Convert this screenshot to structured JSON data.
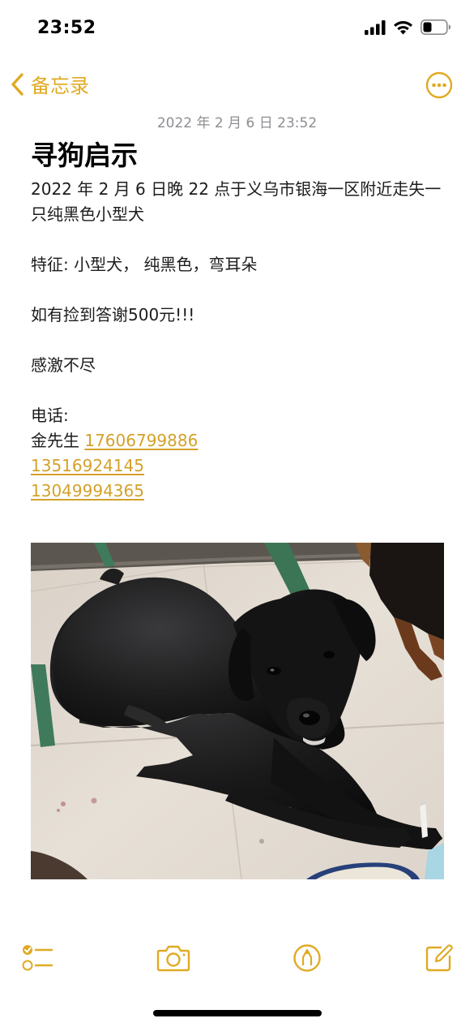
{
  "status_bar": {
    "time": "23:52"
  },
  "nav": {
    "back_label": "备忘录",
    "back_icon": "chevron-left-icon",
    "more_icon": "ellipsis-circle-icon"
  },
  "note": {
    "date": "2022 年 2 月 6 日 23:52",
    "title": "寻狗启示",
    "line1": "2022 年 2 月 6 日晚 22 点于义乌市银海一区附近走失一只纯黑色小型犬",
    "features": "特征: 小型犬， 纯黑色，弯耳朵",
    "reward": "如有捡到答谢500元!!!",
    "thanks": "感激不尽",
    "phone_label": "电话:",
    "contact_name": "金先生 ",
    "phones": [
      "17606799886",
      "13516924145",
      "13049994365"
    ],
    "photo_icon": "dog-photo"
  },
  "toolbar": {
    "checklist_icon": "checklist-icon",
    "camera_icon": "camera-icon",
    "markup_icon": "markup-pen-icon",
    "compose_icon": "compose-icon"
  },
  "colors": {
    "accent": "#e0aa23",
    "link": "#d4a12a",
    "date_gray": "#8e8e93"
  }
}
